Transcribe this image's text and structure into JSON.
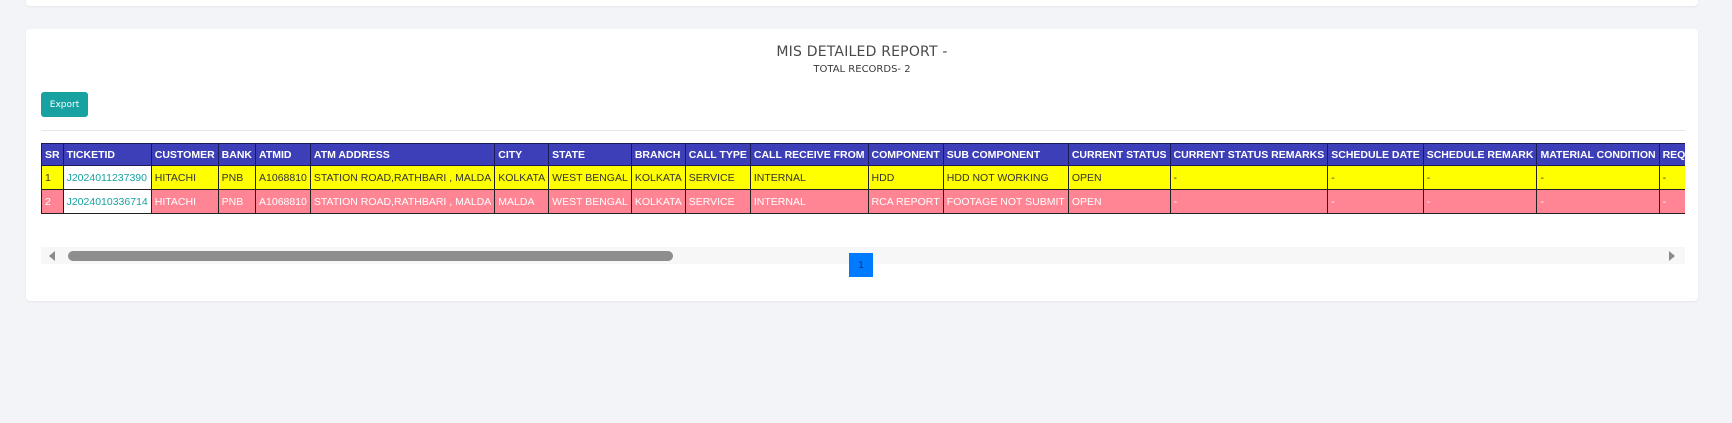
{
  "report": {
    "title": "MIS DETAILED REPORT -",
    "subtitle": "TOTAL RECORDS- 2",
    "export_label": "Export"
  },
  "table": {
    "columns": [
      "SR",
      "TICKETID",
      "CUSTOMER",
      "BANK",
      "ATMID",
      "ATM ADDRESS",
      "CITY",
      "STATE",
      "BRANCH",
      "CALL TYPE",
      "CALL RECEIVE FROM",
      "COMPONENT",
      "SUB COMPONENT",
      "CURRENT STATUS",
      "CURRENT STATUS REMARKS",
      "SCHEDULE DATE",
      "SCHEDULE REMARK",
      "MATERIAL CONDITION",
      "REQUIRED MA"
    ],
    "rows": [
      {
        "color": "#ffff00",
        "cells": [
          "1",
          "J2024011237390",
          "HITACHI",
          "PNB",
          "A1068810",
          "STATION ROAD,RATHBARI , MALDA",
          "KOLKATA",
          "WEST BENGAL",
          "KOLKATA",
          "SERVICE",
          "INTERNAL",
          "HDD",
          "HDD NOT WORKING",
          "OPEN",
          "-",
          "-",
          "-",
          "-",
          "-"
        ]
      },
      {
        "color": "#ff8594",
        "cells": [
          "2",
          "J2024010336714",
          "HITACHI",
          "PNB",
          "A1068810",
          "STATION ROAD,RATHBARI , MALDA",
          "MALDA",
          "WEST BENGAL",
          "KOLKATA",
          "SERVICE",
          "INTERNAL",
          "RCA REPORT",
          "FOOTAGE NOT SUBMIT",
          "OPEN",
          "-",
          "-",
          "-",
          "-",
          "-"
        ]
      }
    ]
  },
  "pagination": {
    "current_page": "1"
  },
  "colors": {
    "header_bg": "#3d3fb9",
    "row_open_yellow": "#ffff00",
    "row_open_pink": "#ff8594",
    "accent_teal": "#17a2a1",
    "pager_blue": "#007bff"
  }
}
